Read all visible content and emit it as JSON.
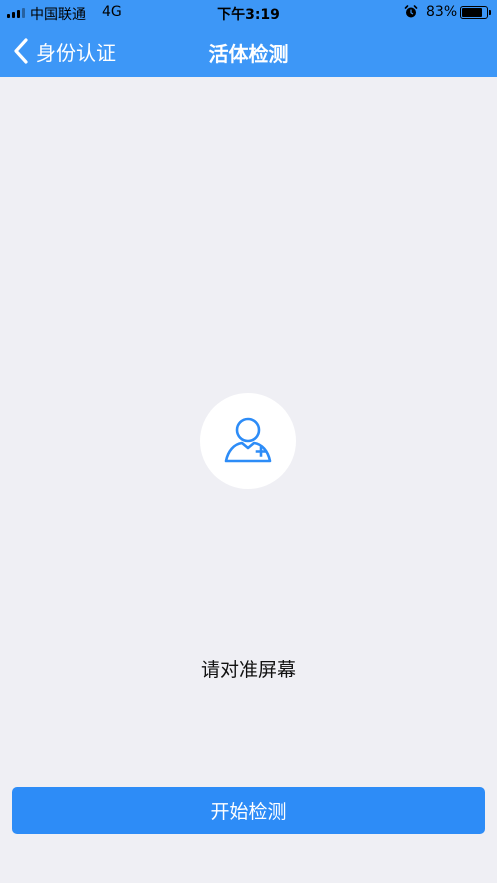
{
  "status_bar": {
    "carrier": "中国联通",
    "network": "4G",
    "time": "下午3:19",
    "battery_percent": "83%",
    "battery_level": 0.83,
    "alarm_icon": "alarm-clock-icon"
  },
  "nav": {
    "back_label": "身份认证",
    "back_icon": "chevron-left-icon",
    "title": "活体检测"
  },
  "main": {
    "avatar_icon": "user-medical-icon",
    "hint": "请对准屏幕",
    "start_button": "开始检测"
  },
  "colors": {
    "nav_bg": "#3d97f7",
    "page_bg": "#efeff4",
    "button_bg": "#2d8cf7",
    "icon_stroke": "#2d8cf7"
  }
}
